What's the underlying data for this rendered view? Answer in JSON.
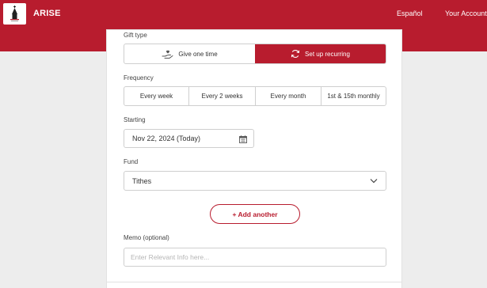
{
  "header": {
    "brand": "ARISE",
    "nav": {
      "espanol": "Español",
      "account": "Your Account"
    }
  },
  "colors": {
    "accent": "#b81c2e",
    "border": "#cfcfcf",
    "background": "#ededed"
  },
  "form": {
    "gift_type": {
      "label": "Gift type",
      "options": [
        {
          "label": "Give one time",
          "icon": "hand-heart-icon",
          "selected": false
        },
        {
          "label": "Set up recurring",
          "icon": "refresh-icon",
          "selected": true
        }
      ]
    },
    "frequency": {
      "label": "Frequency",
      "options": [
        "Every week",
        "Every 2 weeks",
        "Every month",
        "1st & 15th monthly"
      ]
    },
    "starting": {
      "label": "Starting",
      "value": "Nov 22, 2024 (Today)",
      "icon": "calendar-icon"
    },
    "fund": {
      "label": "Fund",
      "value": "Tithes",
      "icon": "chevron-down-icon"
    },
    "add_another": "+ Add another",
    "memo": {
      "label": "Memo (optional)",
      "placeholder": "Enter Relevant Info here..."
    }
  }
}
